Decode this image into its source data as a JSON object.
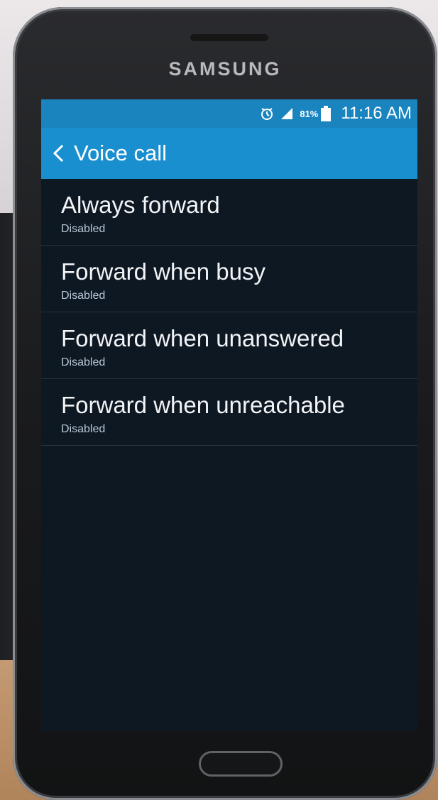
{
  "device": {
    "brand": "SAMSUNG"
  },
  "status_bar": {
    "icons": [
      "alarm-icon",
      "signal-icon",
      "battery-icon"
    ],
    "battery_percent": "81%",
    "time": "11:16 AM"
  },
  "action_bar": {
    "title": "Voice call",
    "back_icon": "chevron-left-icon"
  },
  "settings": [
    {
      "title": "Always forward",
      "status": "Disabled"
    },
    {
      "title": "Forward when busy",
      "status": "Disabled"
    },
    {
      "title": "Forward when unanswered",
      "status": "Disabled"
    },
    {
      "title": "Forward when unreachable",
      "status": "Disabled"
    }
  ],
  "colors": {
    "status_bar": "#1a84bf",
    "action_bar": "#1a8fd0",
    "screen_background": "#0e1823"
  }
}
